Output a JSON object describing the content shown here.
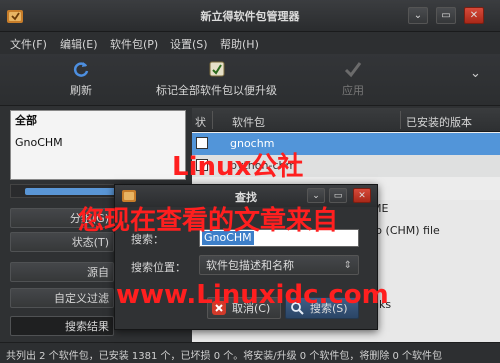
{
  "window": {
    "title": "新立得软件包管理器",
    "buttons": [
      "⌄",
      "▭",
      "✕"
    ]
  },
  "menu": [
    "文件(F)",
    "编辑(E)",
    "软件包(P)",
    "设置(S)",
    "帮助(H)"
  ],
  "toolbar": {
    "refresh_label": "刷新",
    "mark_upgrades_label": "标记全部软件包以便升级",
    "apply_label": "应用",
    "overflow": "⌄"
  },
  "filters": {
    "items": [
      "全部",
      "GnoCHM"
    ],
    "buttons": [
      "分组(G)",
      "状态(T)",
      "源自",
      "自定义过滤",
      "搜索结果"
    ]
  },
  "table": {
    "headers": [
      "状",
      "软件包",
      "已安装的版本"
    ],
    "rows": [
      {
        "name": "gnochm"
      },
      {
        "name": "python-chm"
      }
    ]
  },
  "details": {
    "fragment_1": "ME",
    "fragment_2": "lp (CHM) file",
    "fragment_3": "nks"
  },
  "statusbar": {
    "text": "共列出 2 个软件包，已安装 1381 个，已坏损 0 个。将安装/升级 0 个软件包，将删除 0 个软件包"
  },
  "dialog": {
    "title": "查找",
    "buttons": [
      "⌄",
      "▭",
      "✕"
    ],
    "search_label": "搜索：",
    "search_value": "GnoCHM",
    "location_label": "搜索位置：",
    "location_value": "软件包描述和名称",
    "cancel_label": "取消(C)",
    "search_button_label": "搜索(S)"
  },
  "watermark": {
    "line1": "Linux公社",
    "line2": "您现在查看的文章来自",
    "line3": "www.Linuxidc.com"
  },
  "colors": {
    "selection": "#5295d9",
    "watermark": "#ff1f1f",
    "close_button": "#c9391f"
  }
}
